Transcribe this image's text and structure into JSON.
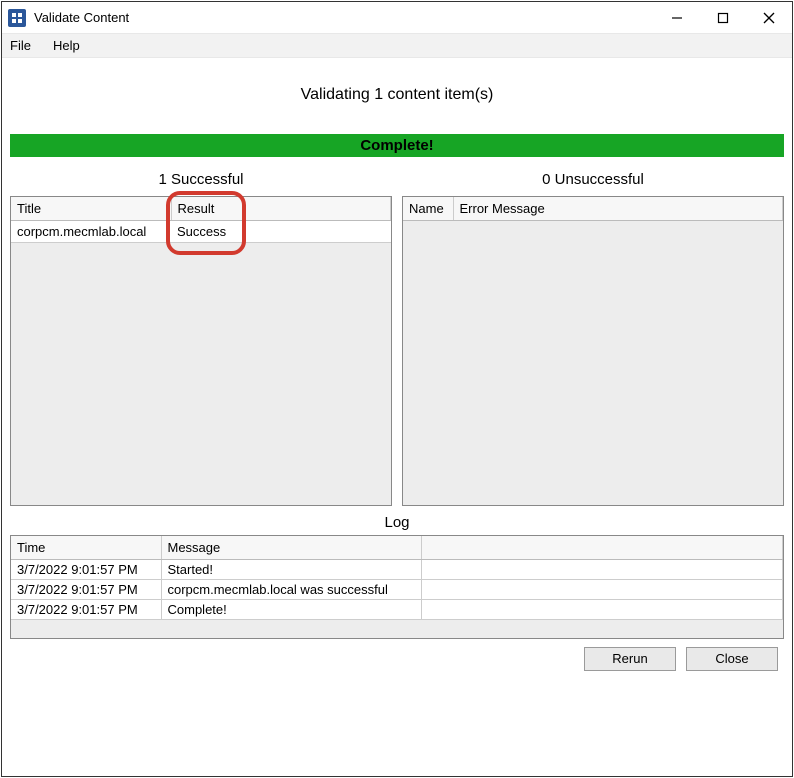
{
  "window": {
    "title": "Validate Content"
  },
  "menu": {
    "file": "File",
    "help": "Help"
  },
  "header": {
    "status_text": "Validating 1 content item(s)",
    "banner": "Complete!"
  },
  "panes": {
    "successful": {
      "title": "1 Successful",
      "columns": {
        "title": "Title",
        "result": "Result"
      },
      "rows": [
        {
          "title": "corpcm.mecmlab.local",
          "result": "Success"
        }
      ]
    },
    "unsuccessful": {
      "title": "0 Unsuccessful",
      "columns": {
        "name": "Name",
        "error": "Error Message"
      },
      "rows": []
    }
  },
  "log": {
    "title": "Log",
    "columns": {
      "time": "Time",
      "message": "Message"
    },
    "rows": [
      {
        "time": "3/7/2022 9:01:57 PM",
        "message": "Started!"
      },
      {
        "time": "3/7/2022 9:01:57 PM",
        "message": "corpcm.mecmlab.local was successful"
      },
      {
        "time": "3/7/2022 9:01:57 PM",
        "message": "Complete!"
      }
    ]
  },
  "footer": {
    "rerun": "Rerun",
    "close": "Close"
  }
}
